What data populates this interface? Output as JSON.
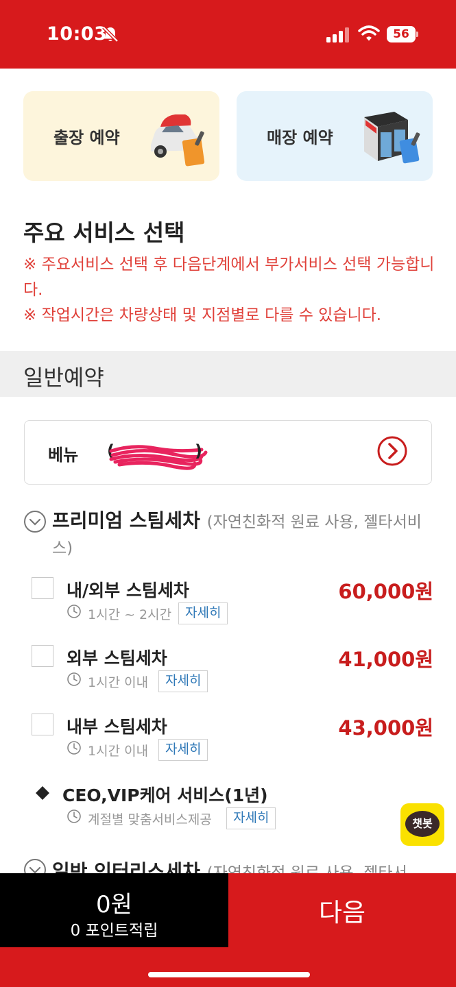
{
  "status_bar": {
    "time": "10:03",
    "battery": "56",
    "bg_color": "#d71a1c"
  },
  "reserve_options": {
    "onsite_label": "출장 예약",
    "store_label": "매장 예약"
  },
  "main_service": {
    "title": "주요 서비스 선택",
    "notice_1": "※ 주요서비스 선택 후 다음단계에서 부가서비스 선택 가능합니다.",
    "notice_2": "※ 작업시간은 차량상태 및 지점별로 다를 수 있습니다."
  },
  "general_reservation": {
    "label": "일반예약"
  },
  "vehicle": {
    "name": "베뉴",
    "paren_open": "(",
    "paren_close": ")"
  },
  "premium_category": {
    "title": "프리미엄 스팀세차",
    "desc": "(자연친화적 원료 사용, 젤타서비스)",
    "items": [
      {
        "name": "내/외부 스팀세차",
        "time": "1시간 ~ 2시간",
        "price": "60,000원",
        "detail_label": "자세히"
      },
      {
        "name": "외부 스팀세차",
        "time": "1시간 이내",
        "price": "41,000원",
        "detail_label": "자세히"
      },
      {
        "name": "내부 스팀세차",
        "time": "1시간 이내",
        "price": "43,000원",
        "detail_label": "자세히"
      }
    ],
    "special_item": {
      "name": "CEO,VIP케어 서비스(1년)",
      "time": "계절별 맞춤서비스제공",
      "detail_label": "자세히"
    }
  },
  "next_category": {
    "title": "일반 인터리스세차",
    "desc": "(자연친화적 원료 사용, 젤타서"
  },
  "chatbot": {
    "label": "챗봇",
    "color": "#fae100"
  },
  "footer": {
    "total": "0원",
    "points": "0 포인트적립",
    "next_label": "다음",
    "accent": "#d71a1c"
  }
}
